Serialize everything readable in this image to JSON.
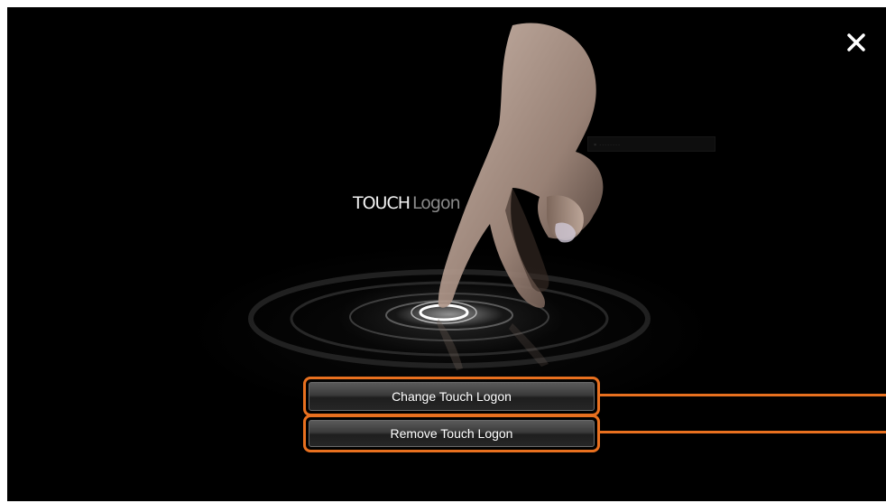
{
  "window": {
    "close_label": "✕"
  },
  "header": {
    "title_bold": "TOUCH",
    "title_light": "Logon",
    "small_label": "▪ ········"
  },
  "actions": {
    "change_label": "Change Touch Logon",
    "remove_label": "Remove Touch Logon"
  },
  "colors": {
    "background": "#000000",
    "highlight": "#e8701f",
    "button_text": "#ffffff"
  }
}
